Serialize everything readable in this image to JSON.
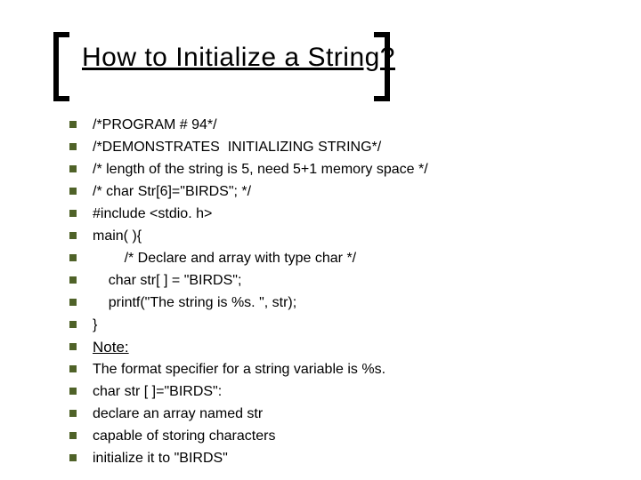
{
  "title": "How to Initialize a String?",
  "lines": [
    {
      "text": "/*PROGRAM # 94*/",
      "style": "plain"
    },
    {
      "text": "/*DEMONSTRATES  INITIALIZING STRING*/",
      "style": "plain"
    },
    {
      "text": "/* length of the string is 5, need 5+1 memory space */",
      "style": "plain"
    },
    {
      "text": "/* char Str[6]=\"BIRDS\"; */",
      "style": "plain"
    },
    {
      "text": "#include <stdio. h>",
      "style": "plain"
    },
    {
      "text": "main( ){",
      "style": "plain"
    },
    {
      "text": "        /* Declare and array with type char */",
      "style": "plain"
    },
    {
      "text": "    char str[ ] = \"BIRDS\";",
      "style": "plain"
    },
    {
      "text": "    printf(\"The string is %s. \", str);",
      "style": "plain"
    },
    {
      "text": "}",
      "style": "plain"
    },
    {
      "text": "Note:",
      "style": "note"
    },
    {
      "text": "The format specifier for a string variable is %s.",
      "style": "plain"
    },
    {
      "text": "char str [ ]=\"BIRDS\":",
      "style": "plain"
    },
    {
      "text": "declare an array named str",
      "style": "plain"
    },
    {
      "text": "capable of storing characters",
      "style": "plain"
    },
    {
      "text": "initialize it to \"BIRDS\"",
      "style": "plain"
    }
  ]
}
